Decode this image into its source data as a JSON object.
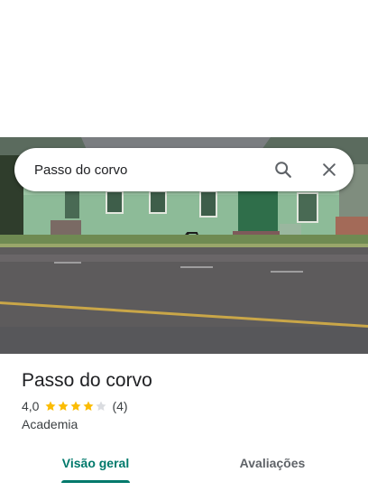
{
  "search": {
    "value": "Passo do corvo"
  },
  "icons": {
    "search": "search-icon",
    "close": "close-icon",
    "star": "star-icon"
  },
  "place": {
    "title": "Passo do corvo",
    "rating": "4,0",
    "rating_fraction": 0.8,
    "stars_filled": 4,
    "stars_total": 5,
    "review_count": "(4)",
    "category": "Academia"
  },
  "tabs": [
    {
      "label": "Visão geral",
      "active": true
    },
    {
      "label": "Avaliações",
      "active": false
    }
  ],
  "colors": {
    "accent": "#00796b",
    "star": "#fbbc04",
    "star_empty": "#dadce0"
  }
}
